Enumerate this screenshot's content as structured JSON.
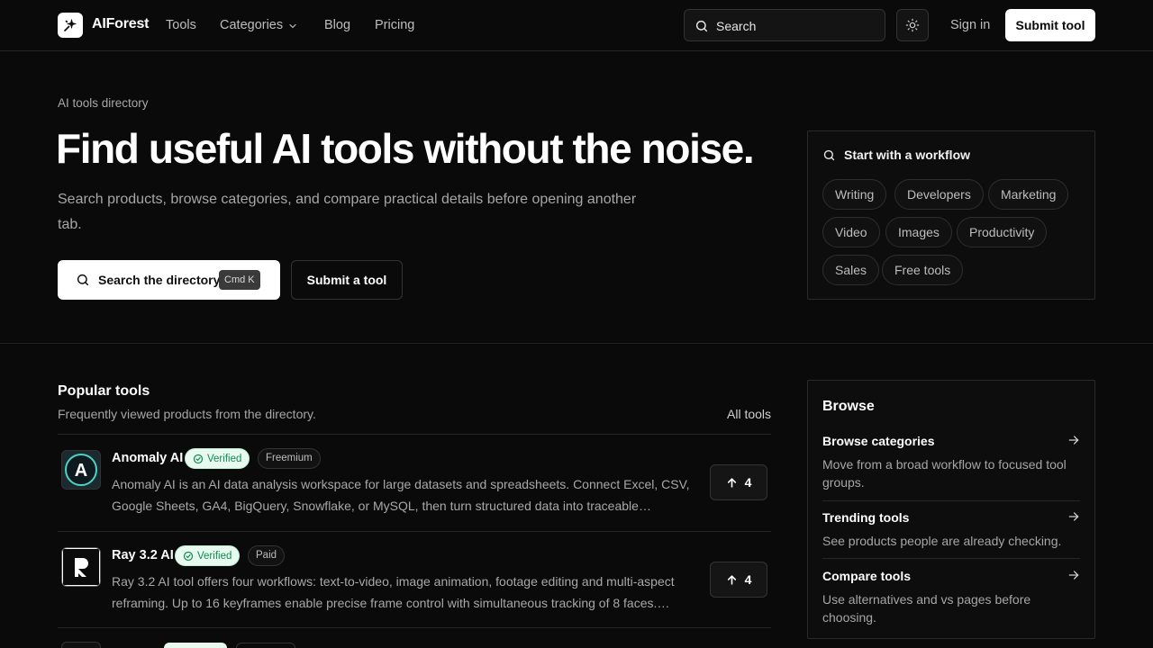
{
  "nav": {
    "brand": "AIForest",
    "links": [
      "Tools",
      "Categories",
      "Blog",
      "Pricing"
    ],
    "search_label": "Search",
    "sign_in": "Sign in",
    "submit": "Submit tool"
  },
  "hero": {
    "eyebrow": "AI tools directory",
    "title": "Find useful AI tools without the noise.",
    "subtitle": "Search products, browse categories, and compare practical details before opening another tab.",
    "search_button": "Search the directory",
    "shortcut": "Cmd K",
    "submit_button": "Submit a tool"
  },
  "workflow": {
    "title": "Start with a workflow",
    "chips": [
      "Writing",
      "Developers",
      "Marketing",
      "Video",
      "Images",
      "Productivity",
      "Sales",
      "Free tools"
    ]
  },
  "popular": {
    "title": "Popular tools",
    "subtitle": "Frequently viewed products from the directory.",
    "all_link": "All tools",
    "tools": [
      {
        "name": "Anomaly AI",
        "verified": "Verified",
        "pricing": "Freemium",
        "desc": "Anomaly AI is an AI data analysis workspace for large datasets and spreadsheets. Connect Excel, CSV, Google Sheets, GA4, BigQuery, Snowflake, or MySQL, then turn structured data into traceable…",
        "votes": "4"
      },
      {
        "name": "Ray 3.2 AI",
        "verified": "Verified",
        "pricing": "Paid",
        "desc": "Ray 3.2 AI tool offers four workflows: text-to-video, image animation, footage editing and multi-aspect reframing. Up to 16 keyframes enable precise frame control with simultaneous tracking of 8 faces.…",
        "votes": "4"
      }
    ]
  },
  "browse": {
    "title": "Browse",
    "items": [
      {
        "title": "Browse categories",
        "desc": "Move from a broad workflow to focused tool groups."
      },
      {
        "title": "Trending tools",
        "desc": "See products people are already checking."
      },
      {
        "title": "Compare tools",
        "desc": "Use alternatives and vs pages before choosing."
      }
    ]
  },
  "colors": {
    "background": "#0a0a0a",
    "verified_bg": "#e8faf0",
    "verified_text": "#118a4e"
  }
}
